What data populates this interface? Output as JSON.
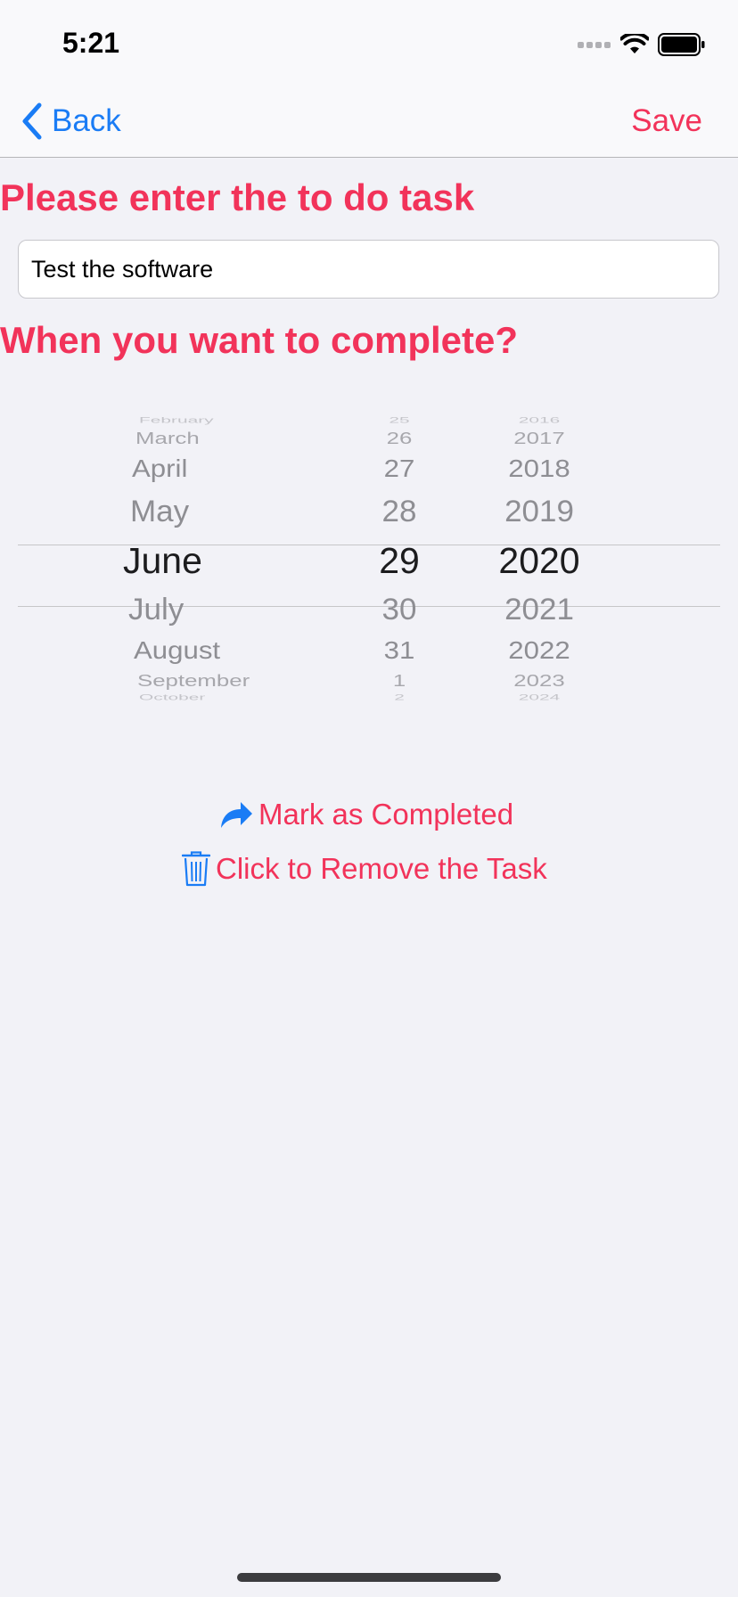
{
  "status": {
    "time": "5:21"
  },
  "nav": {
    "back_label": "Back",
    "save_label": "Save"
  },
  "form": {
    "task_heading": "Please enter the to do task",
    "task_value": "Test the software",
    "date_heading": "When you want to complete?"
  },
  "picker": {
    "months": [
      "February",
      "March",
      "April",
      "May",
      "June",
      "July",
      "August",
      "September",
      "October"
    ],
    "days": [
      "25",
      "26",
      "27",
      "28",
      "29",
      "30",
      "31",
      "1",
      "2"
    ],
    "years": [
      "2016",
      "2017",
      "2018",
      "2019",
      "2020",
      "2021",
      "2022",
      "2023",
      "2024"
    ],
    "selected": {
      "month": "June",
      "day": "29",
      "year": "2020"
    }
  },
  "actions": {
    "complete_label": "Mark as Completed",
    "remove_label": "Click to Remove the Task"
  },
  "colors": {
    "accent": "#f2335a",
    "link": "#1a7cf5",
    "background": "#f2f2f7"
  }
}
